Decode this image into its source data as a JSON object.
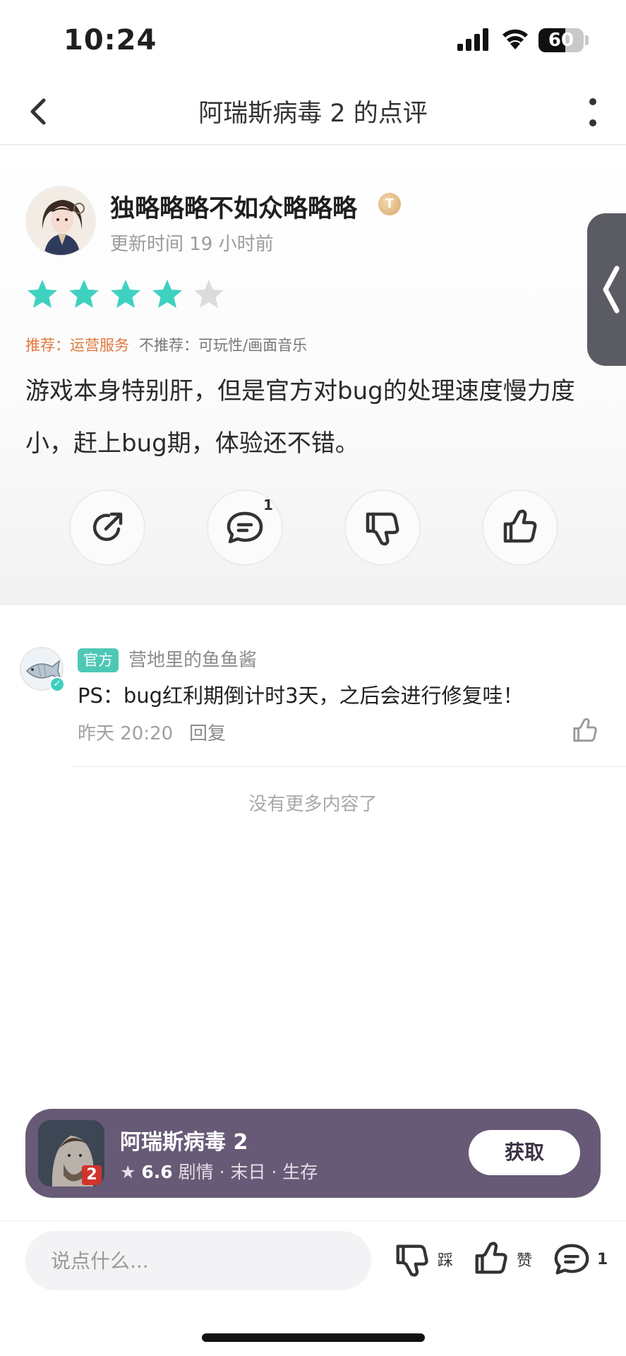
{
  "status_bar": {
    "time": "10:24",
    "battery": "60",
    "battery_level": 0.6
  },
  "nav": {
    "title": "阿瑞斯病毒 2 的点评",
    "back_icon": "chevron-left-icon",
    "more_icon": "more-vertical-icon"
  },
  "review": {
    "username": "独略略略不如众略略略",
    "badge": "T",
    "update_time": "更新时间 19 小时前",
    "rating": 4,
    "rating_max": 5,
    "recommend_label": "推荐：",
    "recommend_value": "运营服务",
    "not_recommend_label": "不推荐：",
    "not_recommend_value": "可玩性/画面音乐",
    "text": "游戏本身特别肝，但是官方对bug的处理速度慢力度小，赶上bug期，体验还不错。",
    "comment_count": "1"
  },
  "comment": {
    "official_tag": "官方",
    "author": "营地里的鱼鱼酱",
    "text": "PS：bug红利期倒计时3天，之后会进行修复哇！",
    "time": "昨天 20:20",
    "reply_label": "回复"
  },
  "no_more": "没有更多内容了",
  "game": {
    "name": "阿瑞斯病毒 2",
    "rating": "6.6",
    "tags": "剧情 · 末日 · 生存",
    "icon_badge": "2",
    "get_label": "获取"
  },
  "bottom_bar": {
    "input_placeholder": "说点什么...",
    "dislike_label": "踩",
    "like_label": "赞",
    "comment_count": "1"
  },
  "colors": {
    "star_active": "#3fd1c0",
    "star_inactive": "#dcdcdc",
    "recommend": "#e07840",
    "official": "#4ec8b6",
    "game_card": "#675a76"
  }
}
